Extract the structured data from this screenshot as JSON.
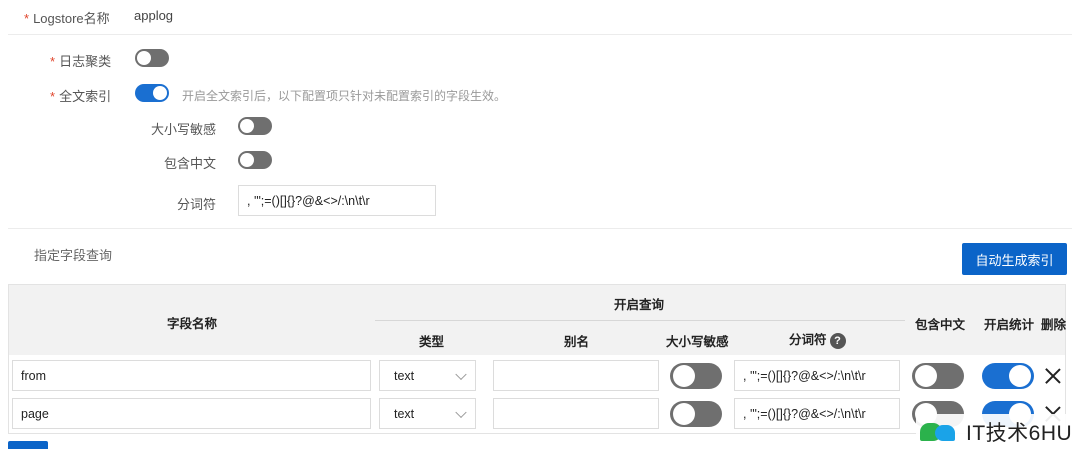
{
  "logstore": {
    "label": "Logstore名称",
    "value": "applog"
  },
  "log_cluster": {
    "label": "日志聚类",
    "enabled": false
  },
  "full_text_index": {
    "label": "全文索引",
    "enabled": true,
    "hint": "开启全文索引后，以下配置项只针对未配置索引的字段生效。",
    "case_sensitive": {
      "label": "大小写敏感",
      "enabled": false
    },
    "include_chinese": {
      "label": "包含中文",
      "enabled": false
    },
    "delimiter": {
      "label": "分词符",
      "value": ", '\";=()[]{}?@&<>/:\\n\\t\\r"
    }
  },
  "field_query": {
    "title": "指定字段查询",
    "auto_button": "自动生成索引",
    "headers": {
      "field_name": "字段名称",
      "enable_query": "开启查询",
      "type": "类型",
      "alias": "别名",
      "case_sensitive": "大小写敏感",
      "delimiter": "分词符",
      "include_chinese": "包含中文",
      "enable_stats": "开启统计",
      "delete": "删除"
    },
    "help_icon": "?",
    "rows": [
      {
        "field": "from",
        "type": "text",
        "alias": "",
        "case_sensitive": false,
        "delimiter": ", '\";=()[]{}?@&<>/:\\n\\t\\r",
        "include_chinese": false,
        "enable_stats": true
      },
      {
        "field": "page",
        "type": "text",
        "alias": "",
        "case_sensitive": false,
        "delimiter": ", '\";=()[]{}?@&<>/:\\n\\t\\r",
        "include_chinese": false,
        "enable_stats": true
      }
    ]
  },
  "watermark": {
    "text": "IT技术6HU"
  },
  "colors": {
    "accent": "#1a6fd1",
    "button": "#0b64c8",
    "required": "#e0452c",
    "toggle_off": "#6f6f6f"
  }
}
